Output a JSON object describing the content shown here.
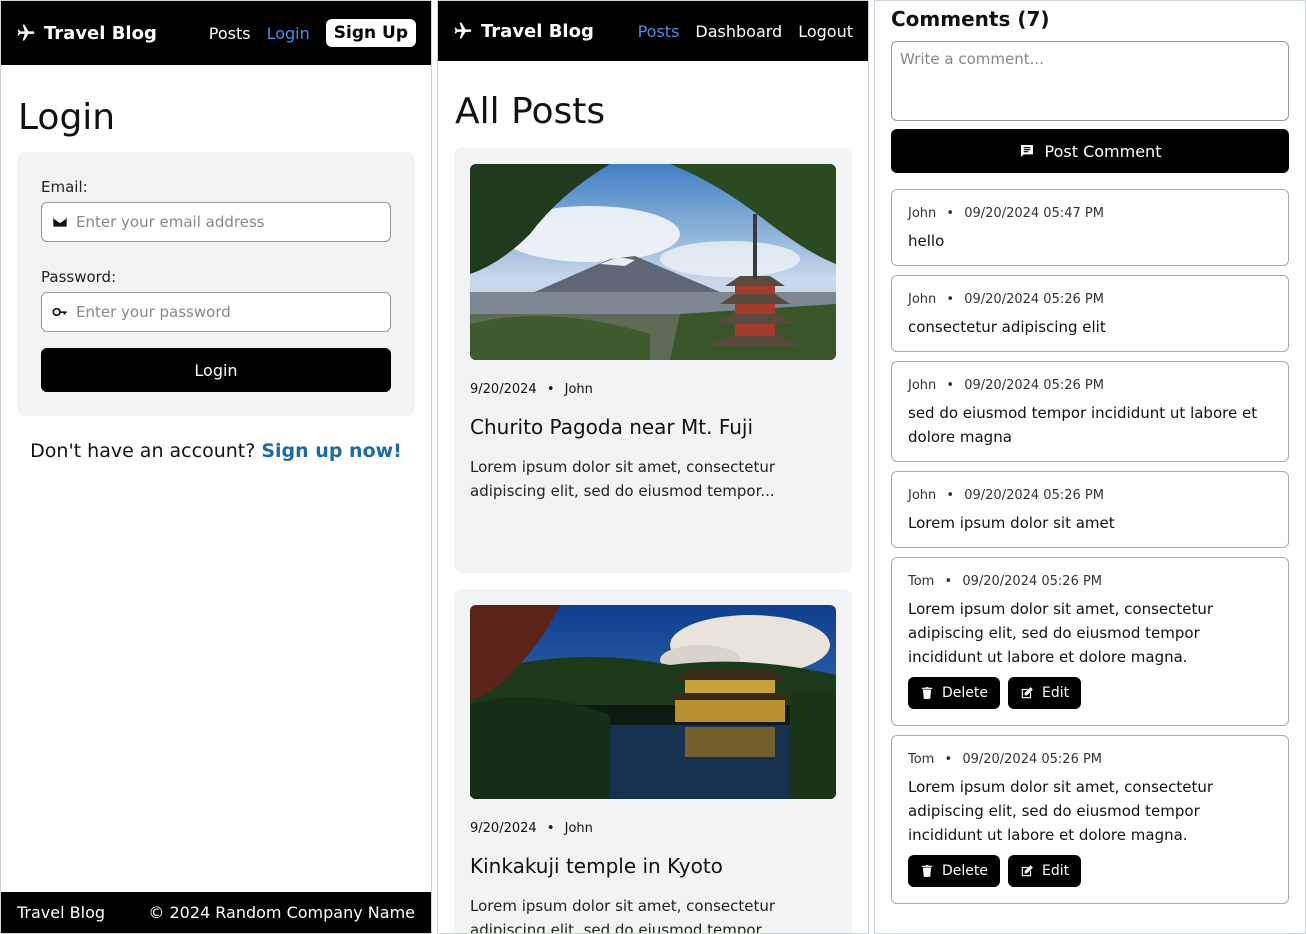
{
  "login_panel": {
    "navbar": {
      "brand": "Travel Blog",
      "links": [
        "Posts",
        "Login"
      ],
      "signup": "Sign Up"
    },
    "title": "Login",
    "email": {
      "label": "Email:",
      "placeholder": "Enter your email address"
    },
    "password": {
      "label": "Password:",
      "placeholder": "Enter your password"
    },
    "login_button": "Login",
    "signup_prompt": "Don't have an account?",
    "signup_link": "Sign up now!",
    "footer": {
      "brand": "Travel Blog",
      "copyright": "© 2024 Random Company Name"
    }
  },
  "posts_panel": {
    "navbar": {
      "brand": "Travel Blog",
      "links": [
        "Posts",
        "Dashboard",
        "Logout"
      ]
    },
    "title": "All Posts",
    "posts": [
      {
        "date": "9/20/2024",
        "author": "John",
        "title": "Churito Pagoda near Mt. Fuji",
        "excerpt": "Lorem ipsum dolor sit amet, consectetur adipiscing elit, sed do eiusmod tempor..."
      },
      {
        "date": "9/20/2024",
        "author": "John",
        "title": "Kinkakuji temple in Kyoto",
        "excerpt": "Lorem ipsum dolor sit amet, consectetur adipiscing elit, sed do eiusmod tempor..."
      }
    ]
  },
  "comments_panel": {
    "title": "Comments (7)",
    "input_placeholder": "Write a comment...",
    "post_button": "Post Comment",
    "delete_label": "Delete",
    "edit_label": "Edit",
    "separator": "•",
    "comments": [
      {
        "author": "John",
        "timestamp": "09/20/2024 05:47 PM",
        "text": "hello"
      },
      {
        "author": "John",
        "timestamp": "09/20/2024 05:26 PM",
        "text": "consectetur adipiscing elit"
      },
      {
        "author": "John",
        "timestamp": "09/20/2024 05:26 PM",
        "text": "sed do eiusmod tempor incididunt ut labore et dolore magna"
      },
      {
        "author": "John",
        "timestamp": "09/20/2024 05:26 PM",
        "text": "Lorem ipsum dolor sit amet"
      },
      {
        "author": "Tom",
        "timestamp": "09/20/2024 05:26 PM",
        "text": "Lorem ipsum dolor sit amet, consectetur adipiscing elit, sed do eiusmod tempor incididunt ut labore et dolore magna."
      },
      {
        "author": "Tom",
        "timestamp": "09/20/2024 05:26 PM",
        "text": "Lorem ipsum dolor sit amet, consectetur adipiscing elit, sed do eiusmod tempor incididunt ut labore et dolore magna."
      }
    ]
  },
  "icons": {
    "brand": "airplane-icon",
    "email": "envelope-icon",
    "password": "key-icon",
    "post_comment": "comment-icon",
    "delete": "trash-icon",
    "edit": "pencil-square-icon"
  },
  "colors": {
    "navbar_bg": "#000000",
    "active_link": "#4a90e2",
    "signup_link": "#1f6aa5",
    "card_bg": "#f2f3f5"
  }
}
